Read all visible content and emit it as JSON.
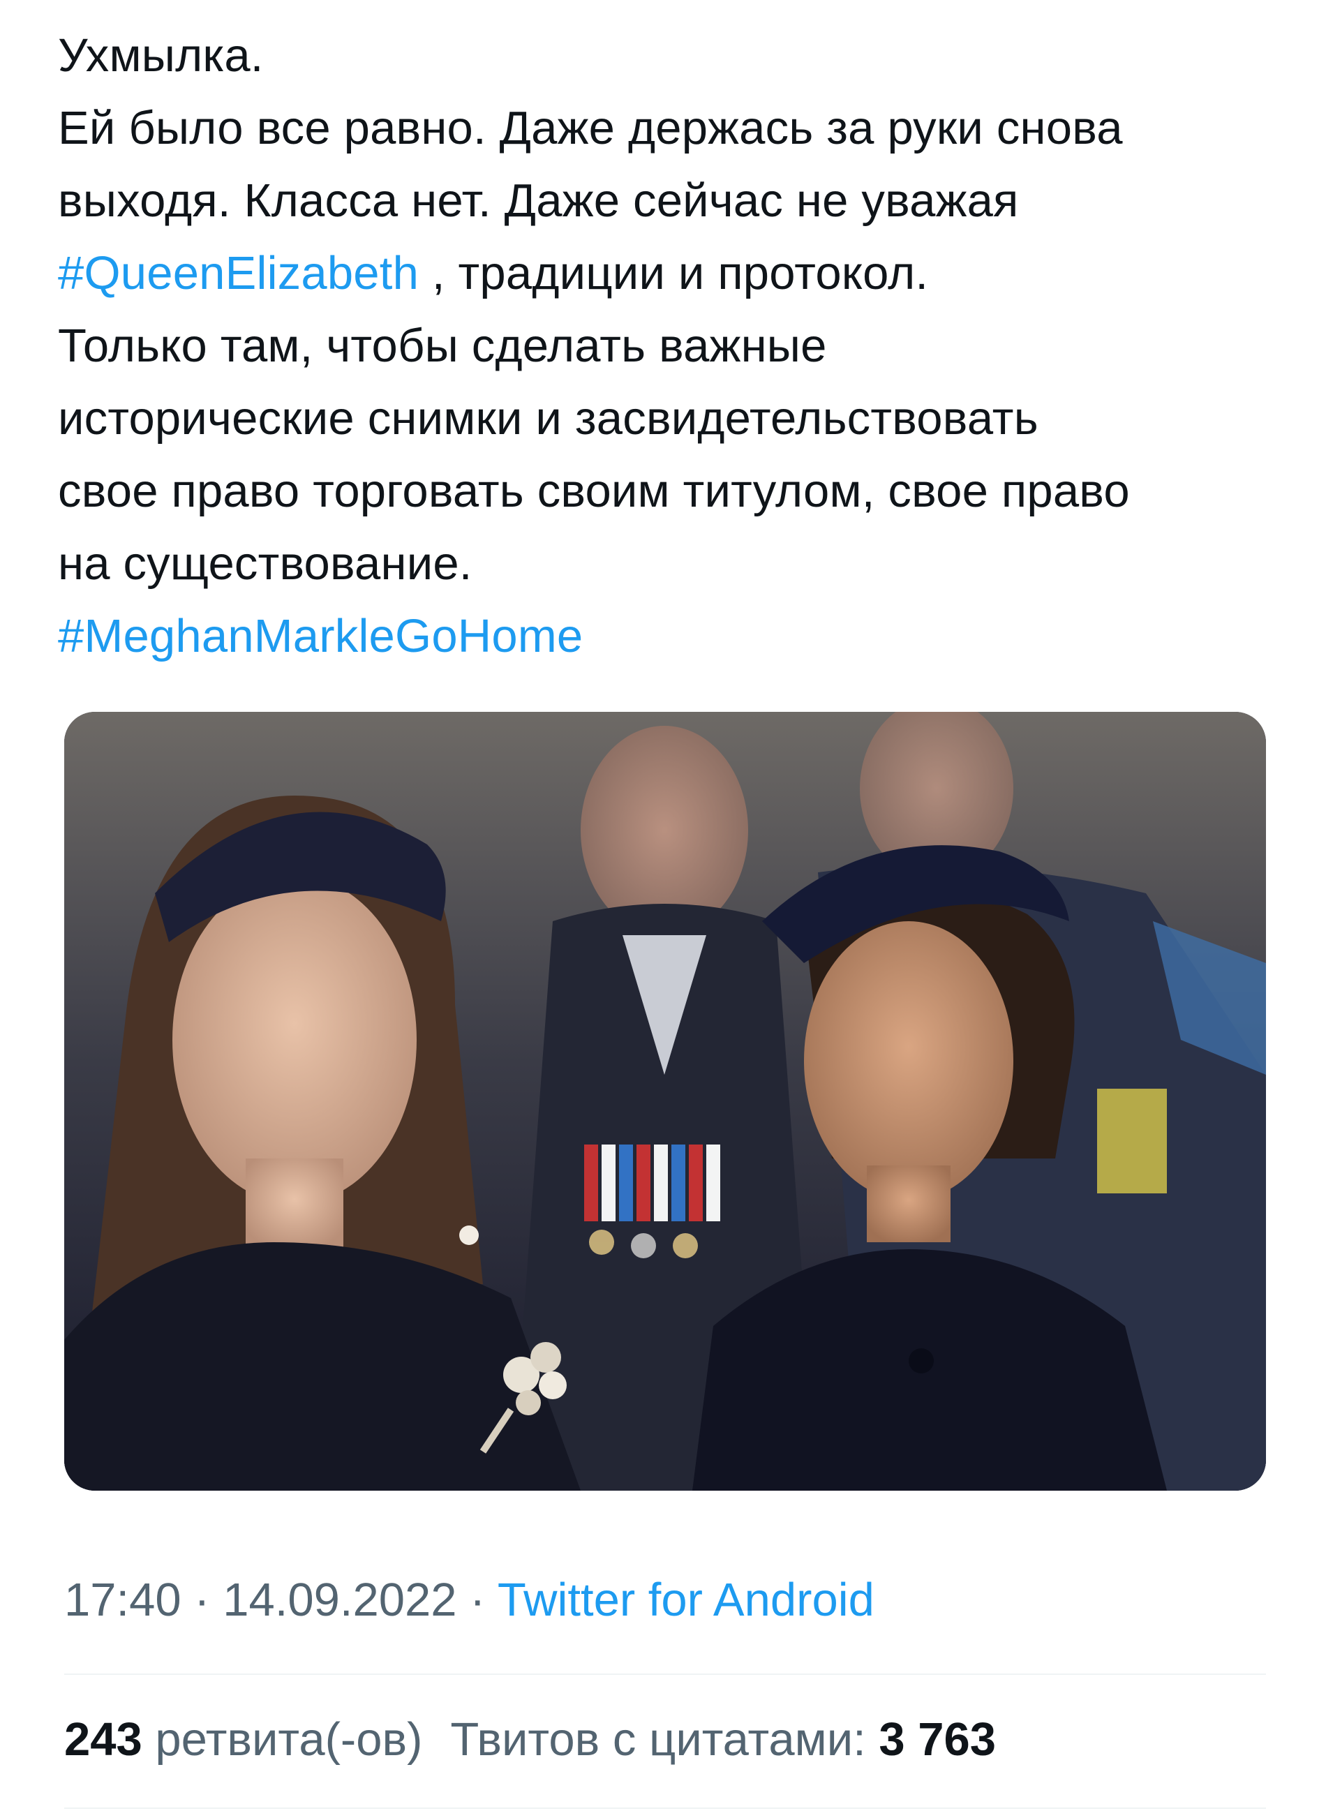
{
  "tweet": {
    "lines": [
      [
        {
          "text": "Ухмылка.",
          "type": "text"
        }
      ],
      [
        {
          "text": "Ей было все равно. Даже держась за руки снова",
          "type": "text"
        }
      ],
      [
        {
          "text": "выходя. Класса нет. Даже сейчас не уважая",
          "type": "text"
        }
      ],
      [
        {
          "text": "#QueenElizabeth",
          "type": "hashtag"
        },
        {
          "text": " , традиции и протокол.",
          "type": "text"
        }
      ],
      [
        {
          "text": "Только там, чтобы сделать важные",
          "type": "text"
        }
      ],
      [
        {
          "text": "исторические снимки и засвидетельствовать",
          "type": "text"
        }
      ],
      [
        {
          "text": "свое право торговать своим титулом, свое право",
          "type": "text"
        }
      ],
      [
        {
          "text": "на существование.",
          "type": "text"
        }
      ],
      [
        {
          "text": "#MeghanMarkleGoHome",
          "type": "hashtag"
        }
      ]
    ]
  },
  "meta": {
    "time": "17:40",
    "separator": " · ",
    "date": "14.09.2022",
    "source": "Twitter for Android"
  },
  "stats": {
    "retweets_count": "243",
    "retweets_label": "ретвита(-ов)",
    "quotes_label": "Твитов с цитатами:",
    "quotes_count": "3 763"
  },
  "colors": {
    "text": "#0f1419",
    "hashtag": "#1d9bf0",
    "secondary": "#536471",
    "divider": "#eff3f4"
  }
}
